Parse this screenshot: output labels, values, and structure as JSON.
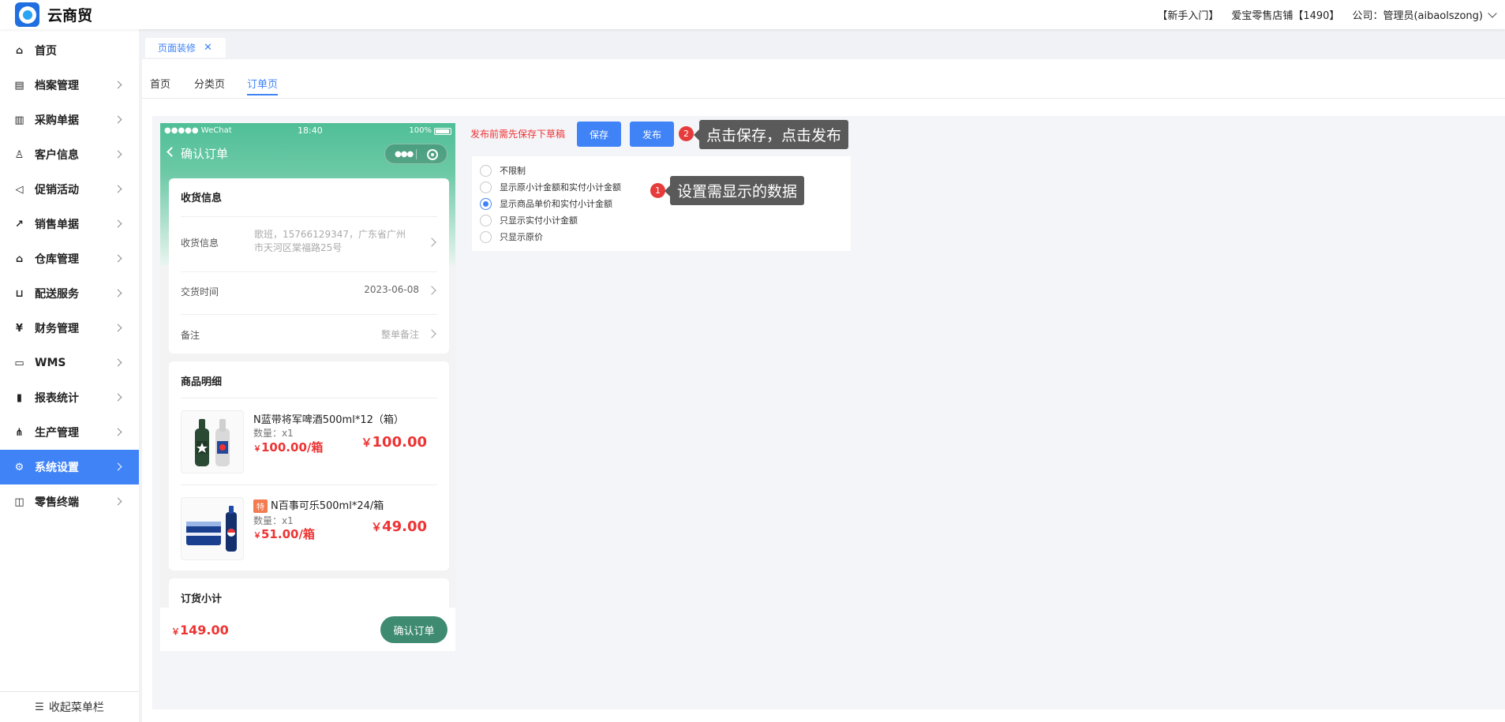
{
  "app": {
    "title": "云商贸"
  },
  "topbar": {
    "guide": "【新手入门】",
    "store": "爱宝零售店铺【1490】",
    "company": "公司：管理员(aibaolszong)"
  },
  "sidebar": {
    "items": [
      {
        "label": "首页",
        "icon": "home-icon"
      },
      {
        "label": "档案管理",
        "icon": "archive-icon"
      },
      {
        "label": "采购单据",
        "icon": "purchase-doc-icon"
      },
      {
        "label": "客户信息",
        "icon": "user-icon"
      },
      {
        "label": "促销活动",
        "icon": "megaphone-icon"
      },
      {
        "label": "销售单据",
        "icon": "chart-line-icon"
      },
      {
        "label": "仓库管理",
        "icon": "warehouse-icon"
      },
      {
        "label": "配送服务",
        "icon": "cart-icon"
      },
      {
        "label": "财务管理",
        "icon": "finance-icon"
      },
      {
        "label": "WMS",
        "icon": "truck-icon"
      },
      {
        "label": "报表统计",
        "icon": "bar-chart-icon"
      },
      {
        "label": "生产管理",
        "icon": "network-icon"
      },
      {
        "label": "系统设置",
        "icon": "gear-icon"
      },
      {
        "label": "零售终端",
        "icon": "bag-icon"
      }
    ],
    "collapse_label": "收起菜单栏"
  },
  "page_tab": {
    "label": "页面装修",
    "close": "✕"
  },
  "subtabs": [
    "首页",
    "分类页",
    "订单页"
  ],
  "phone": {
    "status": {
      "signal": "●●●●● WeChat",
      "time": "18:40",
      "battery": "100%"
    },
    "nav_title": "确认订单",
    "receive": {
      "title": "收货信息",
      "address_label": "收货信息",
      "address_line1": "歌班，15766129347，广东省广州",
      "address_line2": "市天河区棠福路25号",
      "time_label": "交货时间",
      "time_value": "2023-06-08",
      "note_label": "备注",
      "note_value": "整单备注"
    },
    "goods": {
      "title": "商品明细",
      "items": [
        {
          "name": "N蓝带将军啤酒500ml*12（箱）",
          "qty": "数量：x1",
          "price": "100.00/箱",
          "total": "100.00",
          "special": ""
        },
        {
          "name": "N百事可乐500ml*24/箱",
          "qty": "数量：x1",
          "price": "51.00/箱",
          "total": "49.00",
          "special": "特"
        }
      ]
    },
    "subtotal_title": "订货小计",
    "footer": {
      "amount": "149.00",
      "confirm": "确认订单"
    },
    "currency": "￥"
  },
  "toolbar": {
    "hint": "发布前需先保存下草稿",
    "save": "保存",
    "publish": "发布",
    "badge2": "2",
    "callout2": "点击保存，点击发布"
  },
  "options": {
    "items": [
      "不限制",
      "显示原小计金额和实付小计金额",
      "显示商品单价和实付小计金额",
      "只显示实付小计金额",
      "只显示原价"
    ],
    "selected_index": 2,
    "badge1": "1",
    "callout1": "设置需显示的数据"
  },
  "colors": {
    "accent": "#4083f7",
    "danger": "#e63b3b",
    "phone_green": "#4fbf97"
  }
}
